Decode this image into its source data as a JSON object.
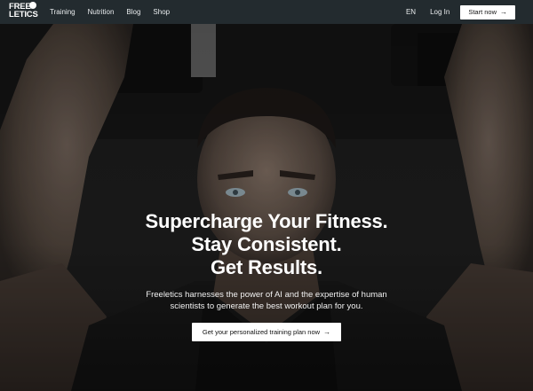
{
  "nav": {
    "logo_line1": "FREE",
    "logo_line2": "LETICS",
    "links": [
      "Training",
      "Nutrition",
      "Blog",
      "Shop"
    ],
    "language": "EN",
    "login": "Log In",
    "start_label": "Start now",
    "arrow": "→"
  },
  "hero": {
    "headline_lines": [
      "Supercharge Your Fitness.",
      "Stay Consistent.",
      "Get Results."
    ],
    "subtext_lines": [
      "Freeletics harnesses the power of AI and the expertise of human",
      "scientists to generate the best workout plan for you."
    ],
    "cta_label": "Get your personalized training plan now",
    "arrow": "→"
  },
  "colors": {
    "nav_background": "#232b2f",
    "button_background": "#ffffff",
    "text": "#ffffff"
  }
}
